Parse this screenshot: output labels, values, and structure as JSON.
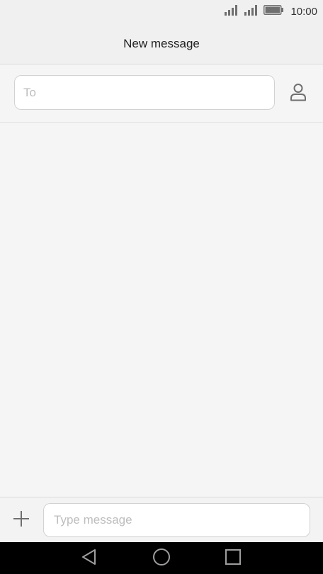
{
  "status_bar": {
    "time": "10:00",
    "icons": [
      "signal-icon",
      "signal-icon",
      "battery-icon"
    ]
  },
  "header": {
    "title": "New message"
  },
  "recipient": {
    "placeholder": "To",
    "value": "",
    "contact_icon": "contact-person-icon"
  },
  "composer": {
    "add_icon": "plus-icon",
    "placeholder": "Type message",
    "value": ""
  },
  "nav_bar": {
    "buttons": [
      "back-triangle-icon",
      "home-circle-icon",
      "recents-square-icon"
    ]
  },
  "colors": {
    "background": "#f5f5f5",
    "header_background": "#f0f0f0",
    "field_border": "#d2d2d2",
    "icon_gray": "#6f6f6f",
    "placeholder": "#bdbdbd",
    "nav_background": "#000000",
    "nav_icon": "#9e9e9e"
  }
}
